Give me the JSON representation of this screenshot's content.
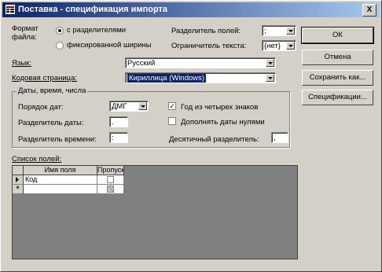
{
  "window": {
    "title": "Поставка - спецификация импорта",
    "close_label": "X"
  },
  "format": {
    "label": "Формат файла:",
    "options": [
      {
        "label": "с разделителями",
        "selected": true
      },
      {
        "label": "фиксированной ширины",
        "selected": false
      }
    ]
  },
  "field_delimiter": {
    "label": "Разделитель полей:",
    "value": ";"
  },
  "text_qualifier": {
    "label": "Ограничитель текста:",
    "value": "{нет}"
  },
  "language": {
    "label": "Язык:",
    "value": "Русский"
  },
  "codepage": {
    "label": "Кодовая страница:",
    "value": "Кириллица (Windows)"
  },
  "dates": {
    "group_label": "Даты, время, числа",
    "date_order_label": "Порядок дат:",
    "date_order_value": "ДМГ",
    "four_digit_year_label": "Год из четырех знаков",
    "four_digit_year_checked": true,
    "date_sep_label": "Разделитель даты:",
    "date_sep_value": ".",
    "leading_zeros_label": "Дополнять даты нулями",
    "leading_zeros_checked": false,
    "time_sep_label": "Разделитель времени:",
    "time_sep_value": ":",
    "decimal_label": "Десятичный разделитель:",
    "decimal_value": ","
  },
  "fields": {
    "label": "Список полей:",
    "columns": [
      "Имя поля",
      "Пропуск"
    ],
    "rows": [
      {
        "name": "Код",
        "skip": false
      }
    ]
  },
  "buttons": {
    "ok": "ОК",
    "cancel": "Отмена",
    "save_as": "Сохранить как...",
    "specs": "Спецификации..."
  }
}
